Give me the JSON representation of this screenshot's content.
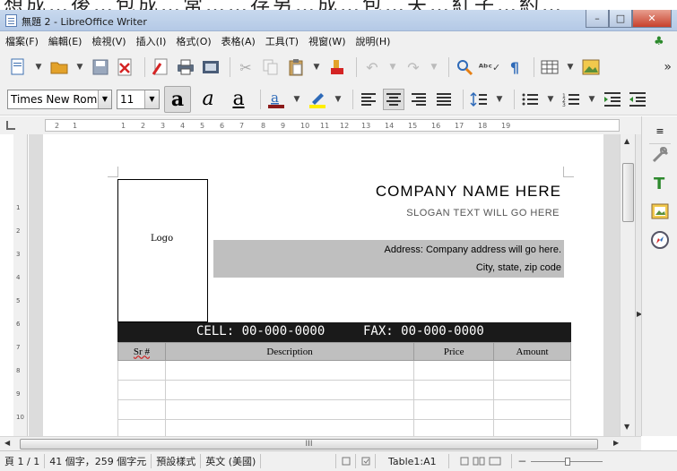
{
  "top_strip_text": "想成…後…包成…常……存另…成…包…夫…紅子…約…",
  "window": {
    "title": "無題 2 - LibreOffice Writer",
    "min": "–",
    "max": "□",
    "close": "✕"
  },
  "menu": [
    "檔案(F)",
    "編輯(E)",
    "檢視(V)",
    "插入(I)",
    "格式(O)",
    "表格(A)",
    "工具(T)",
    "視窗(W)",
    "說明(H)"
  ],
  "toolbar2": {
    "font_name": "Times New Roma",
    "font_size": "11"
  },
  "ruler": [
    "2",
    "1",
    "1",
    "2",
    "3",
    "4",
    "5",
    "6",
    "7",
    "8",
    "9",
    "10",
    "11",
    "12",
    "13",
    "14",
    "15",
    "16",
    "17",
    "18",
    "19"
  ],
  "vruler": [
    "1",
    "2",
    "3",
    "4",
    "5",
    "6",
    "7",
    "8",
    "9",
    "10"
  ],
  "document": {
    "logo": "Logo",
    "company": "COMPANY  NAME  HERE",
    "slogan": "SLOGAN TEXT WILL GO HERE",
    "address_line1": "Address: Company address will go here.",
    "address_line2": "City, state, zip code",
    "cell": "CELL: 00-000-0000",
    "fax": "FAX: 00-000-0000",
    "columns": [
      "Sr #",
      "Description",
      "Price",
      "Amount"
    ]
  },
  "hscroll_label": "III",
  "status": {
    "page": "頁 1 / 1",
    "words": "41 個字，259 個字元",
    "style": "預設樣式",
    "language": "英文 (美國)",
    "table": "Table1:A1"
  },
  "colors": {
    "titlebar": "#b4c9e6",
    "close": "#c7412c",
    "table_header": "#bfbfbf",
    "contact_bar": "#1a1a1a"
  }
}
